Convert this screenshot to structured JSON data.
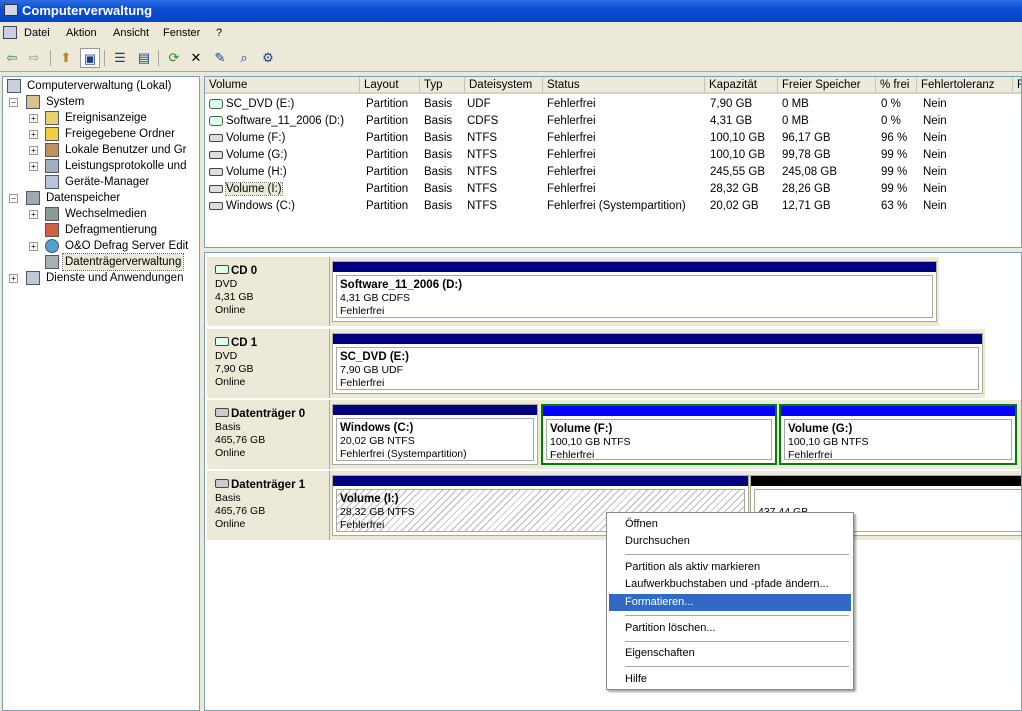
{
  "window": {
    "title": "Computerverwaltung"
  },
  "menu": [
    "Datei",
    "Aktion",
    "Ansicht",
    "Fenster",
    "?"
  ],
  "toolbar": [
    {
      "name": "back-icon",
      "glyph": "⇦"
    },
    {
      "name": "forward-icon",
      "glyph": "⇨"
    },
    {
      "name": "up-folder-icon",
      "glyph": "⬆"
    },
    {
      "name": "show-hide-tree-icon",
      "glyph": "▣"
    },
    {
      "name": "properties-icon",
      "glyph": "☰"
    },
    {
      "name": "action-pane-icon",
      "glyph": "▤"
    },
    {
      "name": "refresh-icon",
      "glyph": "⟳"
    },
    {
      "name": "delete-icon",
      "glyph": "✕"
    },
    {
      "name": "check-icon",
      "glyph": "✎"
    },
    {
      "name": "find-icon",
      "glyph": "⌕"
    },
    {
      "name": "settings-icon",
      "glyph": "⚙"
    }
  ],
  "tree": {
    "root": "Computerverwaltung (Lokal)",
    "system": "System",
    "system_items": [
      "Ereignisanzeige",
      "Freigegebene Ordner",
      "Lokale Benutzer und Gr",
      "Leistungsprotokolle und",
      "Geräte-Manager"
    ],
    "storage": "Datenspeicher",
    "storage_items": [
      "Wechselmedien",
      "Defragmentierung",
      "O&O Defrag Server Edit",
      "Datenträgerverwaltung"
    ],
    "services": "Dienste und Anwendungen"
  },
  "list": {
    "columns": [
      "Volume",
      "Layout",
      "Typ",
      "Dateisystem",
      "Status",
      "Kapazität",
      "Freier Speicher",
      "% frei",
      "Fehlertoleranz",
      "R"
    ],
    "rows": [
      {
        "icon": "cd",
        "cells": [
          "SC_DVD (E:)",
          "Partition",
          "Basis",
          "UDF",
          "Fehlerfrei",
          "7,90 GB",
          "0 MB",
          "0 %",
          "Nein"
        ]
      },
      {
        "icon": "cd",
        "cells": [
          "Software_11_2006 (D:)",
          "Partition",
          "Basis",
          "CDFS",
          "Fehlerfrei",
          "4,31 GB",
          "0 MB",
          "0 %",
          "Nein"
        ]
      },
      {
        "icon": "disk",
        "cells": [
          "Volume (F:)",
          "Partition",
          "Basis",
          "NTFS",
          "Fehlerfrei",
          "100,10 GB",
          "96,17 GB",
          "96 %",
          "Nein"
        ]
      },
      {
        "icon": "disk",
        "cells": [
          "Volume (G:)",
          "Partition",
          "Basis",
          "NTFS",
          "Fehlerfrei",
          "100,10 GB",
          "99,78 GB",
          "99 %",
          "Nein"
        ]
      },
      {
        "icon": "disk",
        "cells": [
          "Volume (H:)",
          "Partition",
          "Basis",
          "NTFS",
          "Fehlerfrei",
          "245,55 GB",
          "245,08 GB",
          "99 %",
          "Nein"
        ]
      },
      {
        "icon": "disk",
        "cells": [
          "Volume (I:)",
          "Partition",
          "Basis",
          "NTFS",
          "Fehlerfrei",
          "28,32 GB",
          "28,26 GB",
          "99 %",
          "Nein"
        ]
      },
      {
        "icon": "disk",
        "cells": [
          "Windows (C:)",
          "Partition",
          "Basis",
          "NTFS",
          "Fehlerfrei (Systempartition)",
          "20,02 GB",
          "12,71 GB",
          "63 %",
          "Nein"
        ]
      }
    ]
  },
  "disks": [
    {
      "name": "CD 0",
      "type": "DVD",
      "size": "4,31 GB",
      "state": "Online",
      "parts": [
        {
          "title": "Software_11_2006  (D:)",
          "size": "4,31 GB CDFS",
          "status": "Fehlerfrei"
        }
      ]
    },
    {
      "name": "CD 1",
      "type": "DVD",
      "size": "7,90 GB",
      "state": "Online",
      "parts": [
        {
          "title": "SC_DVD  (E:)",
          "size": "7,90 GB UDF",
          "status": "Fehlerfrei"
        }
      ]
    },
    {
      "name": "Datenträger 0",
      "type": "Basis",
      "size": "465,76 GB",
      "state": "Online",
      "parts": [
        {
          "title": "Windows  (C:)",
          "size": "20,02 GB NTFS",
          "status": "Fehlerfrei (Systempartition)"
        },
        {
          "title": "Volume  (F:)",
          "size": "100,10 GB NTFS",
          "status": "Fehlerfrei"
        },
        {
          "title": "Volume  (G:)",
          "size": "100,10 GB NTFS",
          "status": "Fehlerfrei"
        }
      ]
    },
    {
      "name": "Datenträger 1",
      "type": "Basis",
      "size": "465,76 GB",
      "state": "Online",
      "parts": [
        {
          "title": "Volume  (I:)",
          "size": "28,32 GB NTFS",
          "status": "Fehlerfrei"
        },
        {
          "title": "",
          "size": "437,44 GB",
          "status": ""
        }
      ]
    }
  ],
  "context_menu": [
    "Öffnen",
    "Durchsuchen",
    "Partition als aktiv markieren",
    "Laufwerkbuchstaben und -pfade ändern...",
    "Formatieren...",
    "Partition löschen...",
    "Eigenschaften",
    "Hilfe"
  ],
  "colors": {
    "partition_header": "#000080",
    "selected_partition_header": "#0000ff",
    "selection_border": "#008000",
    "menu_highlight": "#316ac5",
    "unallocated_header": "#000000"
  }
}
